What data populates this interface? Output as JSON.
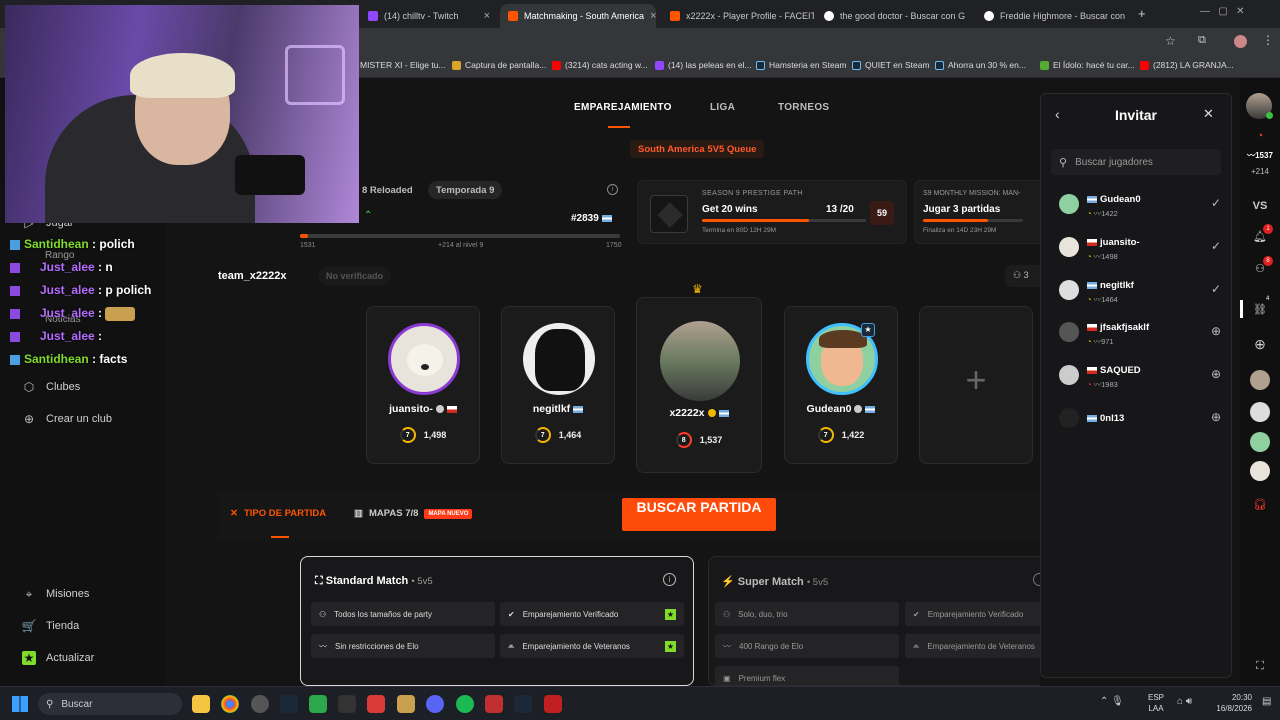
{
  "browser": {
    "tabs": [
      {
        "label": "(14) chilltv - Twitch",
        "active": false
      },
      {
        "label": "Matchmaking - South America",
        "active": true
      },
      {
        "label": "x2222x - Player Profile - FACEIT",
        "active": false
      },
      {
        "label": "the good doctor - Buscar con G",
        "active": false
      },
      {
        "label": "Freddie Highmore - Buscar con",
        "active": false
      }
    ],
    "new_tab": "+",
    "bookmarks": [
      "MISTER XI - Elige tu...",
      "Captura de pantalla...",
      "(3214) cats acting w...",
      "(14) las peleas en el...",
      "Hamsteria en Steam",
      "QUIET en Steam",
      "Ahorra un 30 % en...",
      "El Ídolo: hacé tu car...",
      "(2812) LA GRANJA..."
    ]
  },
  "sidebar": {
    "items_top": [
      "Jugar",
      "Rango",
      "Noticias"
    ],
    "clubs": "Clubes",
    "create_club": "Crear un club",
    "missions": "Misiones",
    "store": "Tienda",
    "update": "Actualizar"
  },
  "chat": [
    {
      "user": "Santidhean",
      "text": ": polich",
      "color": "green"
    },
    {
      "user": "Just_alee",
      "text": ": n",
      "color": "purple"
    },
    {
      "user": "Just_alee",
      "text": ": p polich",
      "color": "purple"
    },
    {
      "user": "Just_alee",
      "text": ":",
      "color": "purple"
    },
    {
      "user": "Just_alee",
      "text": ":",
      "color": "purple"
    },
    {
      "user": "Santidhean",
      "text": ": facts",
      "color": "green"
    }
  ],
  "topnav": {
    "matchmaking": "EMPAREJAMIENTO",
    "league": "LIGA",
    "tournaments": "TORNEOS"
  },
  "queue_badge": "South America 5V5 Queue",
  "season": {
    "title": "8 Reloaded",
    "season_label": "Temporada 9",
    "rank": "#2839",
    "bar_min": "1531",
    "bar_mid": "+214 al nivel 9",
    "bar_max": "1750"
  },
  "prestige": {
    "label": "SEASON 9 PRESTIGE PATH",
    "goal": "Get 20 wins",
    "progress": "13 /20",
    "progress_value": 0.65,
    "time": "Termina en 80D 12H 29M",
    "badge": "59"
  },
  "monthly": {
    "label": "S9 MONTHLY MISSION: MAN-",
    "goal": "Jugar 3 partidas",
    "time": "Finaliza en 14D 23H 29M",
    "progress_value": 0.65
  },
  "team": {
    "name": "team_x2222x",
    "status": "No verificado",
    "members_count": "3"
  },
  "players": [
    {
      "name": "juansito-",
      "elo": "1,498",
      "level": "7",
      "flag": "cl"
    },
    {
      "name": "negitlkf",
      "elo": "1,464",
      "level": "7",
      "flag": "ar"
    },
    {
      "name": "x2222x",
      "elo": "1,537",
      "level": "8",
      "flag": "ar",
      "leader": true
    },
    {
      "name": "Gudean0",
      "elo": "1,422",
      "level": "7",
      "flag": "ar"
    }
  ],
  "add_player": "+",
  "match_tabs": {
    "type": "TIPO DE PARTIDA",
    "maps": "MAPAS 7/8",
    "maps_badge": "MAPA NUEVO"
  },
  "search_button": "BUSCAR PARTIDA",
  "standard": {
    "title": "Standard Match",
    "mode": "• 5v5",
    "features": [
      "Todos los tamaños de party",
      "Emparejamiento Verificado",
      "Sin restricciones de Elo",
      "Emparejamiento de Veteranos"
    ]
  },
  "super": {
    "title": "Super Match",
    "mode": "• 5v5",
    "features": [
      "Solo, duo, trio",
      "Emparejamiento Verificado",
      "400 Rango de Elo",
      "Emparejamiento de Veteranos",
      "Premium flex"
    ]
  },
  "invite": {
    "title": "Invitar",
    "search_placeholder": "Buscar jugadores",
    "friends": [
      {
        "name": "Gudean0",
        "elo": "1422",
        "status": "invited"
      },
      {
        "name": "juansito-",
        "elo": "1498",
        "status": "invited"
      },
      {
        "name": "negitlkf",
        "elo": "1464",
        "status": "invited"
      },
      {
        "name": "jfsakfjsaklf",
        "elo": "971",
        "status": "add"
      },
      {
        "name": "SAQUED",
        "elo": "1983",
        "status": "add"
      },
      {
        "name": "0nl13",
        "elo": "",
        "status": "add"
      }
    ]
  },
  "rightrail": {
    "elo": "1537",
    "delta": "+214",
    "vs": "VS",
    "notif1": "1",
    "notif2": "8",
    "count": "4"
  },
  "taskbar": {
    "search": "Buscar",
    "lang": "ESP",
    "lang2": "LAA",
    "time": "20:30",
    "date": "16/8/2026"
  },
  "colors": {
    "accent": "#ff5500",
    "bg": "#141414",
    "green": "#7fdc2a",
    "purple": "#b56cff"
  }
}
